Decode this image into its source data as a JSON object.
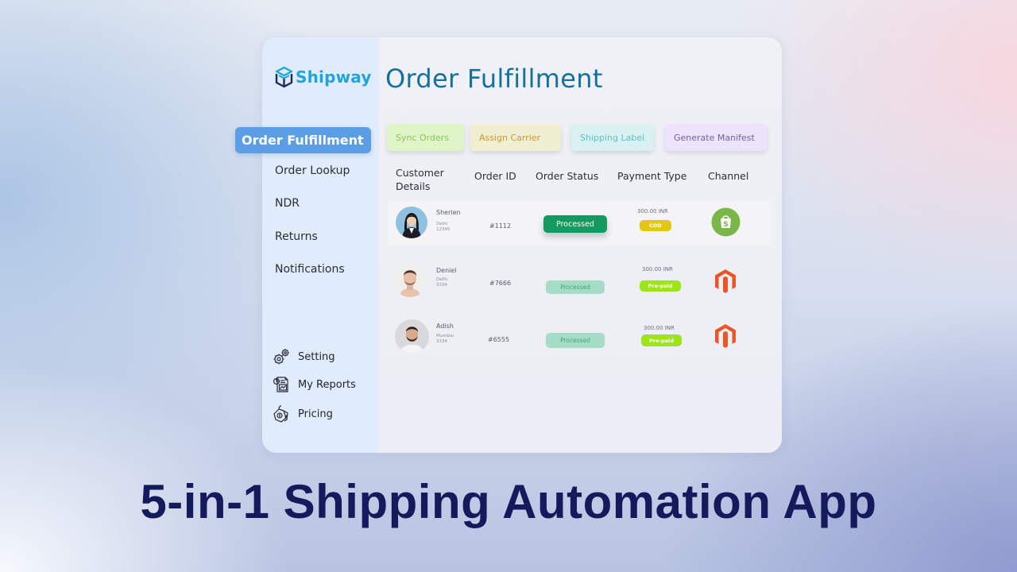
{
  "app": {
    "brand": "Shipway",
    "page_title": "Order Fulfillment"
  },
  "sidebar": {
    "items": [
      {
        "label": "Order Fulfillment",
        "active": true
      },
      {
        "label": "Order Lookup",
        "active": false
      },
      {
        "label": "NDR",
        "active": false
      },
      {
        "label": "Returns",
        "active": false
      },
      {
        "label": "Notifications",
        "active": false
      }
    ],
    "bottom_items": [
      {
        "label": "Setting",
        "icon": "gears-icon"
      },
      {
        "label": "My Reports",
        "icon": "report-icon"
      },
      {
        "label": "Pricing",
        "icon": "price-tag-icon"
      }
    ]
  },
  "actions": [
    {
      "label": "Sync Orders",
      "bg": "#dff5c8",
      "color": "#8cc25a"
    },
    {
      "label": "Assign Carrier",
      "bg": "#f1efd2",
      "color": "#c79a2a"
    },
    {
      "label": "Shipping Label",
      "bg": "#d9f2f1",
      "color": "#5cc0cc"
    },
    {
      "label": "Generate Manifest",
      "bg": "#ede4fb",
      "color": "#6c64a8"
    }
  ],
  "table": {
    "headers": [
      "Customer Details",
      "Order ID",
      "Order Status",
      "Payment Type",
      "Channel"
    ],
    "header_lines": {
      "customer_1": "Customer",
      "customer_2": "Details"
    },
    "rows": [
      {
        "name": "Sherien",
        "city": "Delhi",
        "pin": "12345",
        "order_id": "#1112",
        "status": "Processed",
        "amount": "300.00 INR",
        "payment": "COD",
        "channel": "Shopify"
      },
      {
        "name": "Deniel",
        "city": "Delhi",
        "pin": "3334",
        "order_id": "#7666",
        "status": "Processed",
        "amount": "300.00 INR",
        "payment": "Pre-paid",
        "channel": "Magento"
      },
      {
        "name": "Adish",
        "city": "Mumbai",
        "pin": "3334",
        "order_id": "#6555",
        "status": "Processed",
        "amount": "300.00 INR",
        "payment": "Pre-paid",
        "channel": "Magento"
      }
    ]
  },
  "colors": {
    "brand": "#1ea5de",
    "title": "#15709e",
    "nav_active": "#5b9ee3",
    "status_active": "#149a60",
    "status_muted": "#a6dcc6",
    "cod": "#e4c614",
    "prepaid": "#9ee41a",
    "shopify": "#7ab648",
    "magento": "#e9562a",
    "tagline": "#141a5c"
  },
  "tagline": "5-in-1 Shipping Automation App"
}
